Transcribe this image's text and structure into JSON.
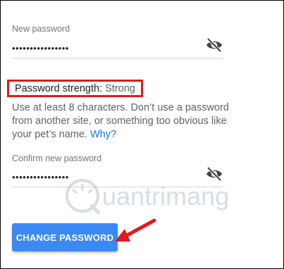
{
  "new_password": {
    "label": "New password",
    "value": "••••••••••••••••",
    "toggle_icon": "eye-off-icon"
  },
  "strength": {
    "label": "Password strength:",
    "value": "Strong"
  },
  "hint": {
    "text": "Use at least 8 characters. Don’t use a password from another site, or something too obvious like your pet’s name.",
    "link": "Why?"
  },
  "confirm_password": {
    "label": "Confirm new password",
    "value": "••••••••••••••••",
    "toggle_icon": "eye-off-icon"
  },
  "actions": {
    "change_label": "CHANGE PASSWORD"
  },
  "watermark": {
    "text": "uantrimang"
  },
  "colors": {
    "accent": "#3b8af3",
    "highlight": "#e21a1a",
    "link": "#1a73e8"
  }
}
